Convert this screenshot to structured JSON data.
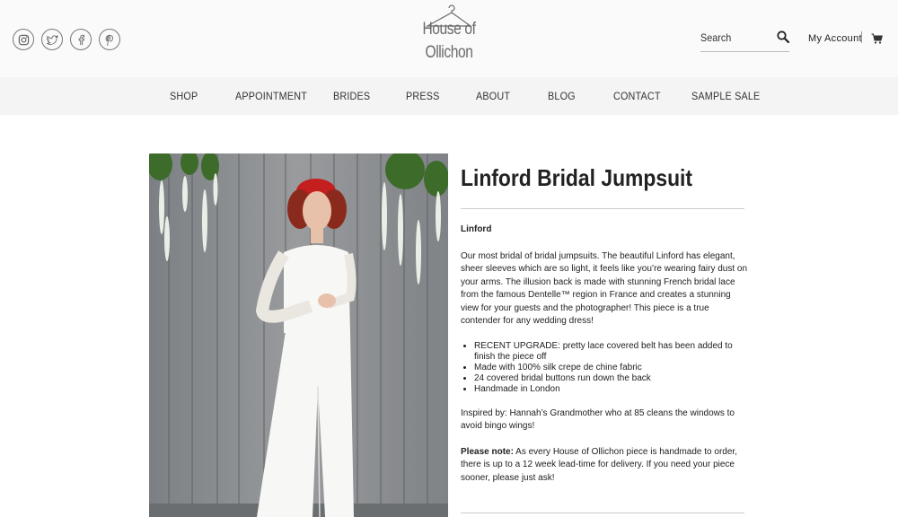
{
  "social": [
    {
      "icon": "instagram-icon"
    },
    {
      "icon": "twitter-icon"
    },
    {
      "icon": "facebook-icon"
    },
    {
      "icon": "pinterest-icon"
    }
  ],
  "logo": {
    "line1": "House of",
    "line2": "Ollichon"
  },
  "search": {
    "placeholder": "Search"
  },
  "account": {
    "label": "My Account"
  },
  "nav": [
    "SHOP",
    "APPOINTMENT",
    "BRIDES",
    "PRESS",
    "ABOUT",
    "BLOG",
    "CONTACT",
    "SAMPLE SALE"
  ],
  "product": {
    "title": "Linford Bridal Jumpsuit",
    "subname": "Linford",
    "intro": "Our most bridal of bridal jumpsuits. The beautiful Linford has elegant, sheer sleeves which are so light, it feels like you’re wearing fairy dust on your arms. The illusion back is made with stunning French bridal lace from the famous Dentelle™ region in France and creates a stunning view for your guests and the photographer! This piece is a true contender for any wedding dress!",
    "bullets": [
      "RECENT UPGRADE: pretty lace covered belt has been added to finish the piece off",
      "Made with 100% silk crepe de chine fabric",
      "24 covered bridal buttons run down the back",
      "Handmade in London"
    ],
    "inspired": "Inspired by: Hannah’s Grandmother who at 85 cleans the windows to avoid bingo wings!",
    "note_label": "Please note:",
    "note_text": " As every House of Ollichon piece is handmade to order, there is up to a 12 week lead-time for delivery. If you need your piece sooner, please just ask!"
  }
}
